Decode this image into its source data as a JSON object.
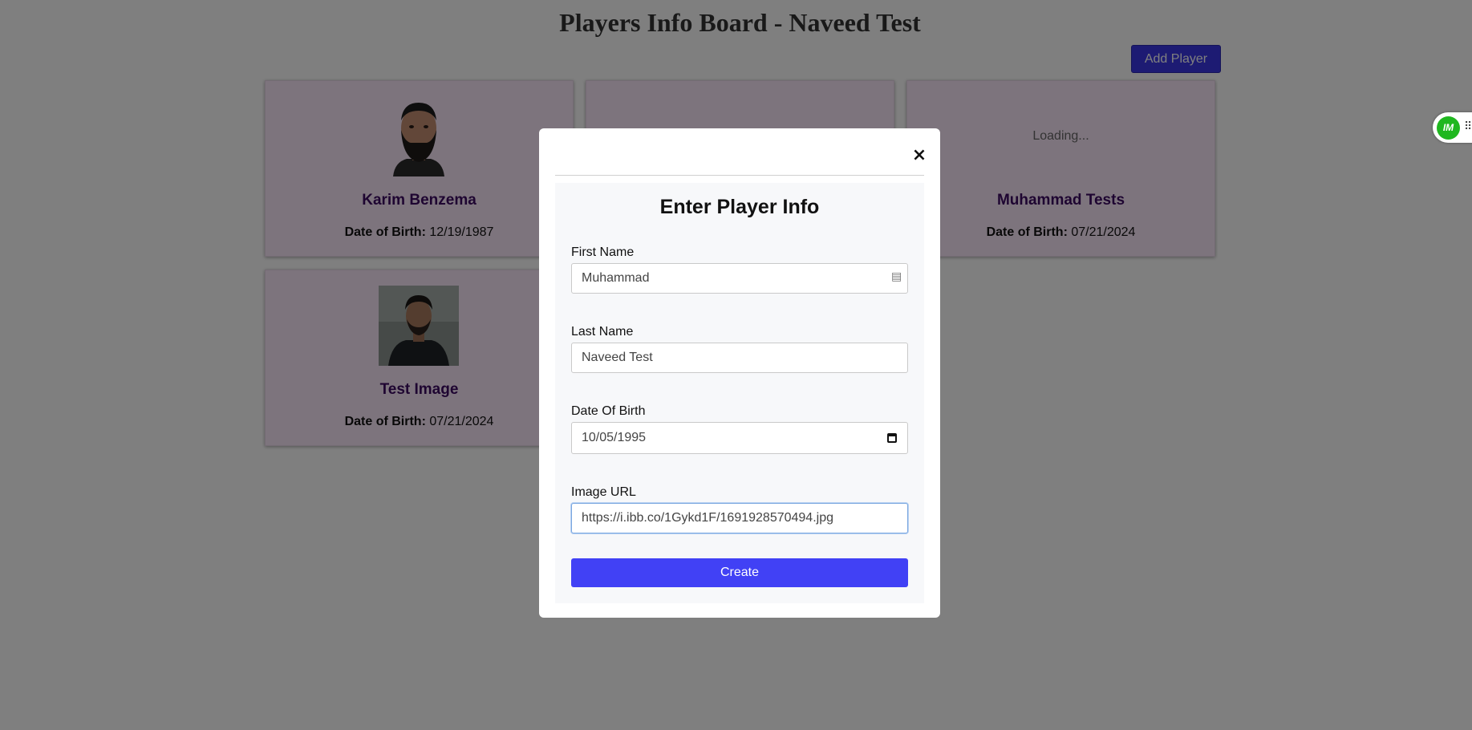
{
  "header": {
    "title": "Players Info Board - Naveed Test",
    "add_player_label": "Add Player"
  },
  "players": [
    {
      "name": "Karim Benzema",
      "dob_label": "Date of Birth:",
      "dob": "12/19/1987",
      "image": "bearded-man-photo"
    },
    {
      "name": "",
      "dob_label": "",
      "dob": "",
      "image": "hidden-by-modal"
    },
    {
      "name": "Muhammad Tests",
      "dob_label": "Date of Birth:",
      "dob": "07/21/2024",
      "loading": "Loading..."
    },
    {
      "name": "Test Image",
      "dob_label": "Date of Birth:",
      "dob": "07/21/2024",
      "image": "man-in-jacket-photo"
    }
  ],
  "modal": {
    "title": "Enter Player Info",
    "close_glyph": "×",
    "fields": {
      "first_name": {
        "label": "First Name",
        "value": "Muhammad"
      },
      "last_name": {
        "label": "Last Name",
        "value": "Naveed Test"
      },
      "dob": {
        "label": "Date Of Birth",
        "value": "10/05/1995"
      },
      "image_url": {
        "label": "Image URL",
        "value": "https://i.ibb.co/1Gykd1F/1691928570494.jpg"
      }
    },
    "create_label": "Create"
  },
  "extension": {
    "logo_text": "IM",
    "icon": "extension-logo-icon"
  },
  "colors": {
    "accent": "#4141f5",
    "card_bg": "#fbe9fb",
    "player_name": "#3d0a63",
    "extension_green": "#1fb71f"
  }
}
